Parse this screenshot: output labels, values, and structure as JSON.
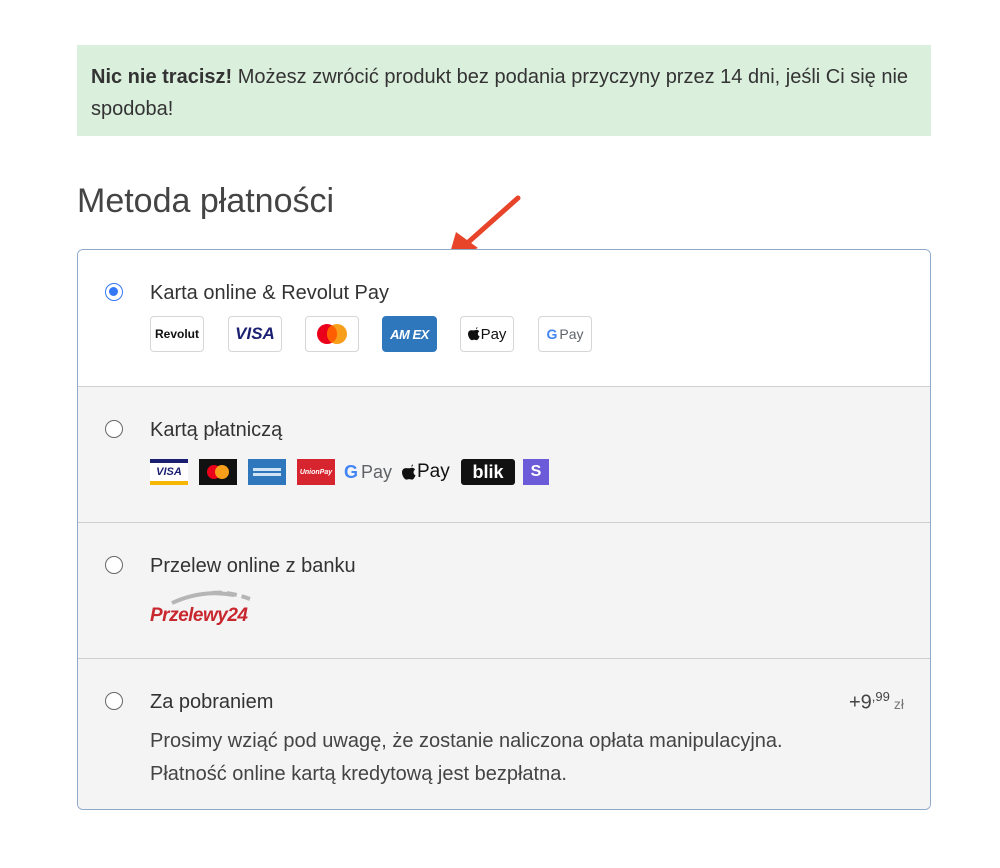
{
  "notice": {
    "bold": "Nic nie tracisz!",
    "text": " Możesz zwrócić produkt bez podania przyczyny przez 14 dni, jeśli Ci się nie spodoba!"
  },
  "payment": {
    "title": "Metoda płatności",
    "options": [
      {
        "label": "Karta online & Revolut Pay",
        "selected": true,
        "badges": [
          "Revolut",
          "VISA",
          "Mastercard",
          "AMEX",
          "Apple Pay",
          "Google Pay"
        ],
        "badge_text": {
          "revolut": "Revolut",
          "visa": "VISA",
          "amex": "AM EX",
          "applepay": "Pay",
          "gpay": "Pay"
        }
      },
      {
        "label": "Kartą płatniczą",
        "selected": false,
        "logos": [
          "VISA",
          "Mastercard",
          "American Express",
          "UnionPay",
          "Google Pay",
          "Apple Pay",
          "BLIK",
          "S"
        ],
        "logo_text": {
          "visa": "VISA",
          "unionpay": "UnionPay",
          "gpay": "Pay",
          "applepay": "Pay",
          "blik": "blik",
          "s": "S"
        }
      },
      {
        "label": "Przelew online z banku",
        "selected": false,
        "logo_text": "Przelewy24"
      },
      {
        "label": "Za pobraniem",
        "selected": false,
        "price_main": "+9",
        "price_decimals": ",99",
        "currency": "zł",
        "description_line1": "Prosimy wziąć pod uwagę, że zostanie naliczona opłata manipulacyjna.",
        "description_line2": "Płatność online kartą kredytową jest bezpłatna."
      }
    ]
  },
  "colors": {
    "notice_bg": "#dbefdd",
    "accent": "#3478f6",
    "arrow": "#e8442a",
    "panel_border": "#8fa9c9"
  }
}
